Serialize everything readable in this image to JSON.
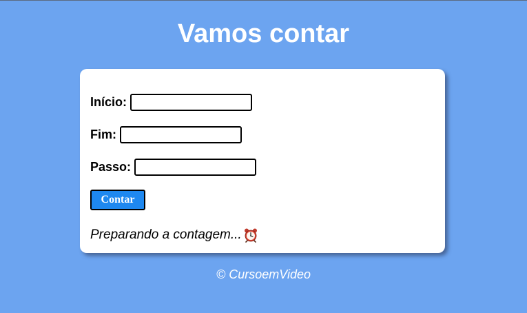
{
  "page": {
    "title": "Vamos contar"
  },
  "form": {
    "inicio_label": "Início:",
    "inicio_value": "",
    "fim_label": "Fim:",
    "fim_value": "",
    "passo_label": "Passo:",
    "passo_value": "",
    "button_label": "Contar"
  },
  "result": {
    "text": "Preparando a contagem...",
    "icon": "alarm-clock-icon"
  },
  "footer": {
    "text": "© CursoemVideo"
  },
  "colors": {
    "background": "#6ca4f0",
    "card": "#ffffff",
    "button": "#1e88f0",
    "title_text": "#ffffff"
  }
}
